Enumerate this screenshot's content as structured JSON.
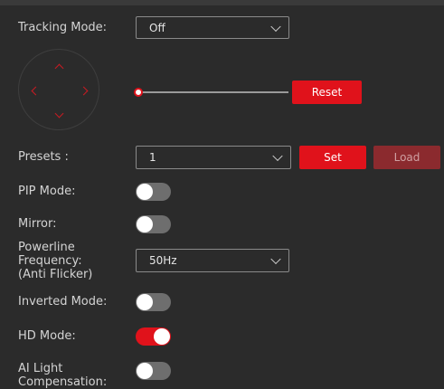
{
  "colors": {
    "accent": "#e0121b",
    "background": "#2b2b2b",
    "toggle_off": "#6e6e6e"
  },
  "tracking": {
    "label": "Tracking Mode:",
    "value": "Off"
  },
  "ptz": {
    "up_icon": "chevron-up-icon",
    "down_icon": "chevron-down-icon",
    "left_icon": "chevron-left-icon",
    "right_icon": "chevron-right-icon",
    "zoom_level": 0,
    "reset_label": "Reset"
  },
  "presets": {
    "label": "Presets :",
    "value": "1",
    "set_label": "Set",
    "load_label": "Load"
  },
  "pip": {
    "label": "PIP Mode:",
    "on": false
  },
  "mirror": {
    "label": "Mirror:",
    "on": false
  },
  "powerline": {
    "label_line1": "Powerline",
    "label_line2": "Frequency:",
    "label_line3": "(Anti Flicker)",
    "value": "50Hz"
  },
  "inverted": {
    "label": "Inverted Mode:",
    "on": false
  },
  "hd": {
    "label": "HD Mode:",
    "on": true
  },
  "ai_light": {
    "label_line1": "AI Light",
    "label_line2": "Compensation:",
    "on": false
  }
}
